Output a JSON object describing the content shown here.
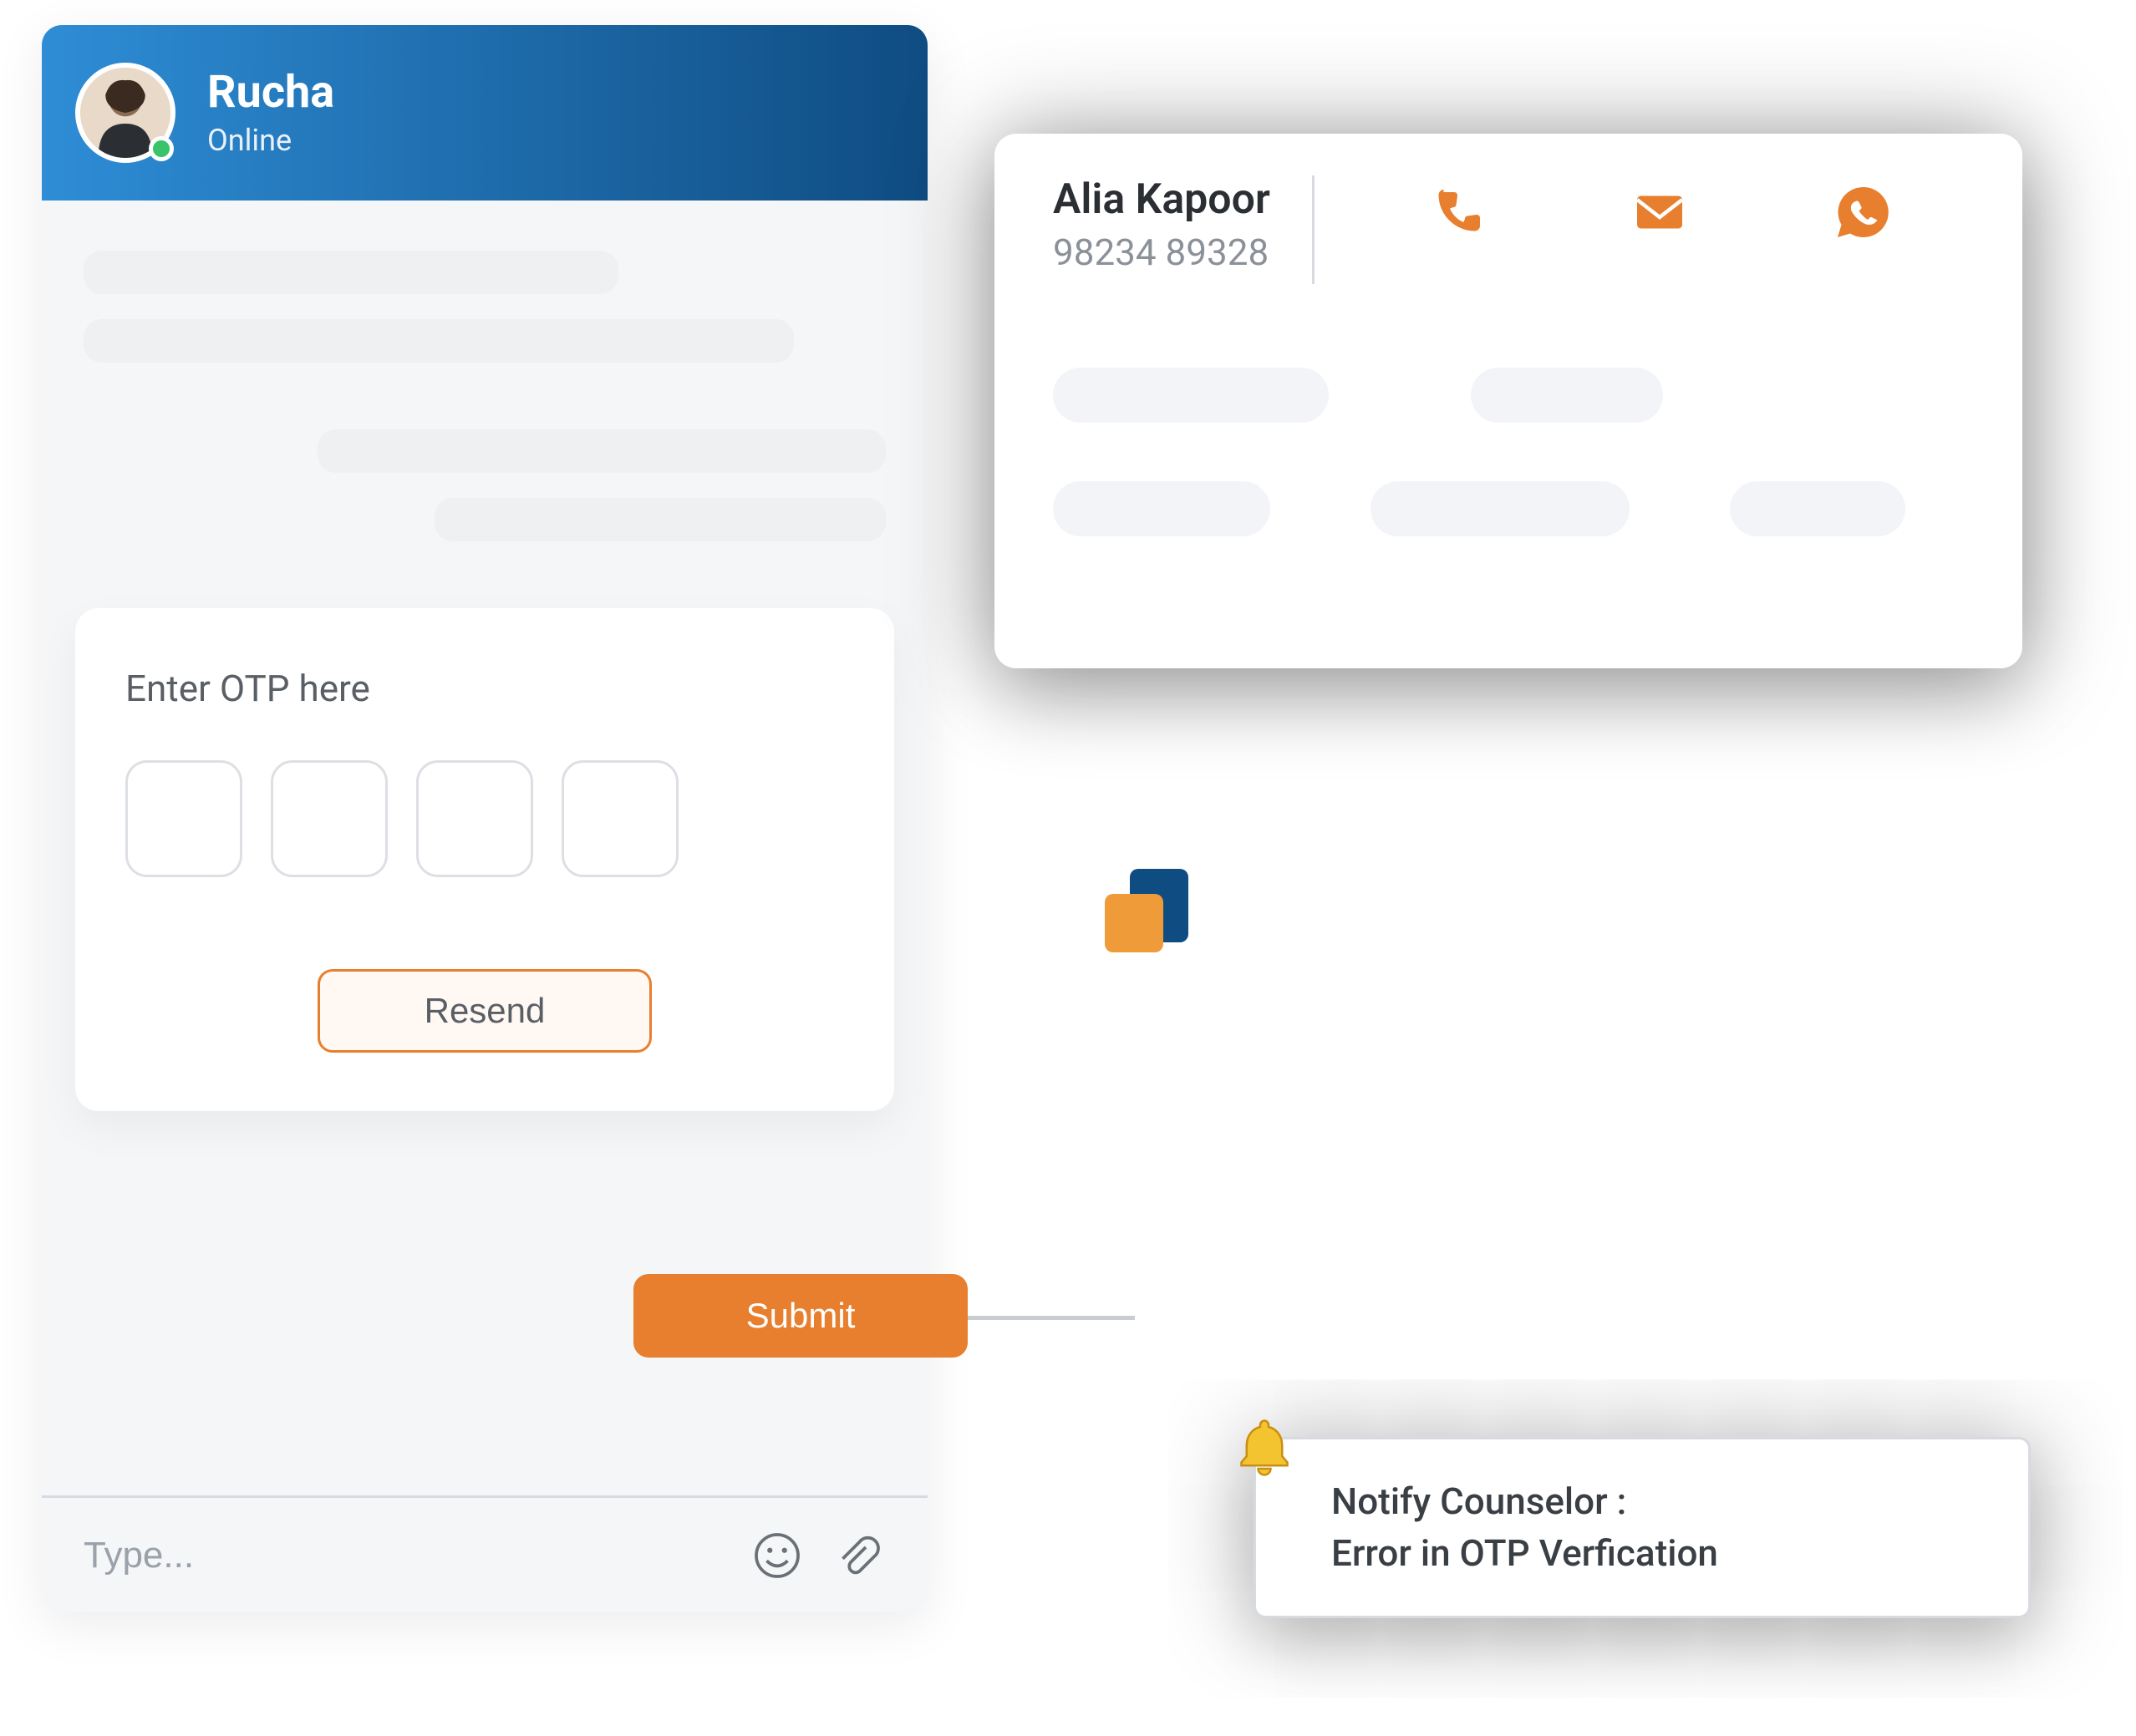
{
  "chat": {
    "agent_name": "Rucha",
    "agent_status": "Online",
    "otp_title": "Enter OTP here",
    "resend_label": "Resend",
    "submit_label": "Submit",
    "composer_placeholder": "Type..."
  },
  "contact": {
    "name": "Alia Kapoor",
    "phone": "98234 89328"
  },
  "notification": {
    "line1": "Notify Counselor :",
    "line2": "Error in OTP Verfication"
  },
  "colors": {
    "accent": "#e77f2e",
    "brand_dark": "#0f4c82",
    "brand_light": "#2e8dd6"
  }
}
